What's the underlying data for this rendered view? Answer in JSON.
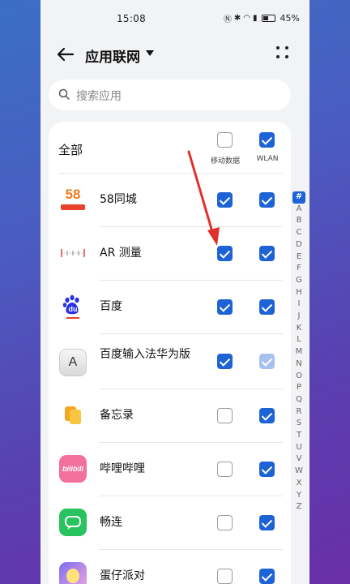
{
  "status_bar": {
    "time": "15:08",
    "battery_pct": "45%",
    "icons": [
      "nfc-icon",
      "bluetooth-icon",
      "wifi-icon",
      "signal-icon",
      "battery-icon"
    ]
  },
  "header": {
    "title": "应用联网"
  },
  "search": {
    "placeholder": "搜索应用"
  },
  "list": {
    "all_label": "全部",
    "col_mobile": "移动数据",
    "col_wlan": "WLAN",
    "all_mobile": false,
    "all_wlan": true,
    "apps": [
      {
        "name": "58同城",
        "mobile": true,
        "wlan": true
      },
      {
        "name": "AR 测量",
        "mobile": true,
        "wlan": true
      },
      {
        "name": "百度",
        "mobile": true,
        "wlan": true
      },
      {
        "name": "百度输入法华为版",
        "mobile": true,
        "wlan": "disabled-checked"
      },
      {
        "name": "备忘录",
        "mobile": false,
        "wlan": true
      },
      {
        "name": "哔哩哔哩",
        "mobile": false,
        "wlan": true
      },
      {
        "name": "畅连",
        "mobile": false,
        "wlan": true
      },
      {
        "name": "蛋仔派对",
        "mobile": false,
        "wlan": true
      }
    ]
  },
  "alpha_index": [
    "#",
    "A",
    "B",
    "C",
    "D",
    "E",
    "F",
    "G",
    "H",
    "I",
    "J",
    "K",
    "L",
    "M",
    "N",
    "O",
    "P",
    "Q",
    "R",
    "S",
    "T",
    "U",
    "V",
    "W",
    "X",
    "Y",
    "Z"
  ],
  "app_icon_text": {
    "wuba": "58",
    "baidu": "du"
  },
  "colors": {
    "accent": "#1e63d6",
    "arrow": "#e0302a"
  }
}
